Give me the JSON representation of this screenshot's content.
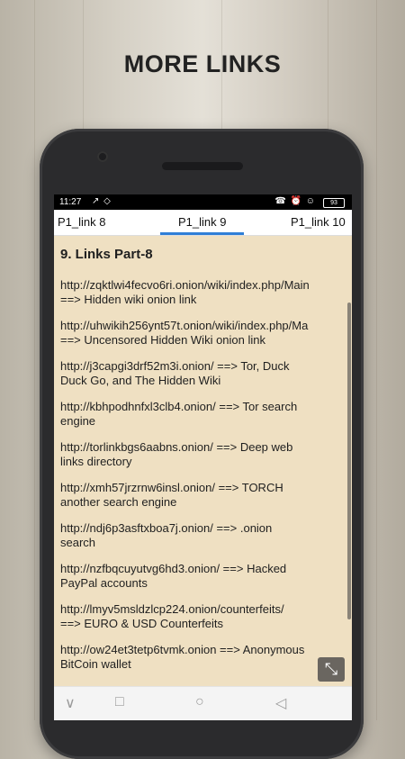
{
  "promo": {
    "title": "MORE LINKS"
  },
  "statusbar": {
    "time": "11:27",
    "left_icons": "↗ ◇",
    "right_icons": "☎ ⏰ ☺",
    "battery": "93"
  },
  "tabs": [
    {
      "label": "P1_link 8"
    },
    {
      "label": "P1_link 9"
    },
    {
      "label": "P1_link 10"
    }
  ],
  "content": {
    "heading": "9. Links Part-8",
    "entries": [
      {
        "line1": "http://zqktlwi4fecvo6ri.onion/wiki/index.php/Main",
        "line2": "==> Hidden wiki onion link"
      },
      {
        "line1": "http://uhwikih256ynt57t.onion/wiki/index.php/Ma",
        "line2": "==> Uncensored Hidden Wiki onion link"
      },
      {
        "line1": "http://j3capgi3drf52m3i.onion/ ==> Tor, Duck",
        "line2": "Duck Go, and The Hidden Wiki"
      },
      {
        "line1": "http://kbhpodhnfxl3clb4.onion/ ==> Tor search",
        "line2": "engine"
      },
      {
        "line1": "http://torlinkbgs6aabns.onion/ ==> Deep web",
        "line2": "links directory"
      },
      {
        "line1": "http://xmh57jrzrnw6insl.onion/ ==> TORCH",
        "line2": "another search engine"
      },
      {
        "line1": "http://ndj6p3asftxboa7j.onion/ ==> .onion",
        "line2": "search"
      },
      {
        "line1": "http://nzfbqcuyutvg6hd3.onion/ ==> Hacked",
        "line2": "PayPal accounts"
      },
      {
        "line1": "http://lmyv5msldzlcp224.onion/counterfeits/",
        "line2": "==> EURO & USD Counterfeits"
      },
      {
        "line1": "http://ow24et3tetp6tvmk.onion ==> Anonymous",
        "line2": "BitCoin wallet"
      }
    ]
  },
  "fullscreen_button": {
    "icon": "shrink-icon",
    "glyph": "⤡"
  },
  "navbar": {
    "icons": [
      "chevron-down-icon",
      "recents-icon",
      "home-icon",
      "back-icon"
    ],
    "glyphs": [
      "∨",
      "□",
      "○",
      "◁"
    ]
  }
}
